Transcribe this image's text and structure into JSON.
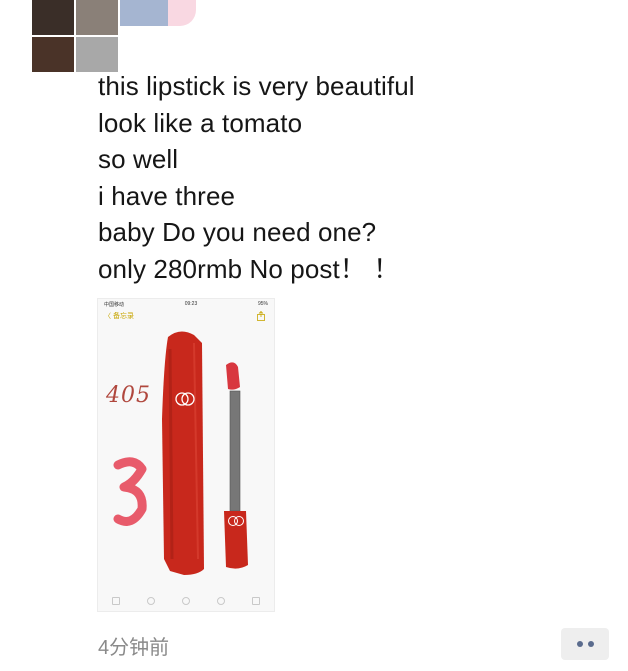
{
  "post": {
    "lines": [
      "this lipstick is very beautiful",
      "look like a tomato",
      "so well",
      "i have three",
      "baby Do you need one?",
      "only 280rmb No post！ ！"
    ],
    "timestamp": "4分钟前"
  },
  "attachment": {
    "status_left": "中国移动",
    "status_time": "09:23",
    "status_right": "95%",
    "back_label": "〈 备忘录",
    "handwriting": {
      "shade": "405",
      "count": "3"
    },
    "toolbar_icons": [
      "trash-icon",
      "check-icon",
      "add-icon",
      "pen-icon",
      "compose-icon"
    ]
  },
  "colors": {
    "text": "#161616",
    "timestamp": "#8a8a8a",
    "lipstick_red": "#c8281c",
    "handwriting_pink": "#e85b6b",
    "handwriting_brown": "#b0473d",
    "more_dots": "#5a6b8d"
  },
  "avatar_colors": [
    "#3a2e28",
    "#8a8078",
    "#4a3328",
    "#a8a8a8"
  ]
}
